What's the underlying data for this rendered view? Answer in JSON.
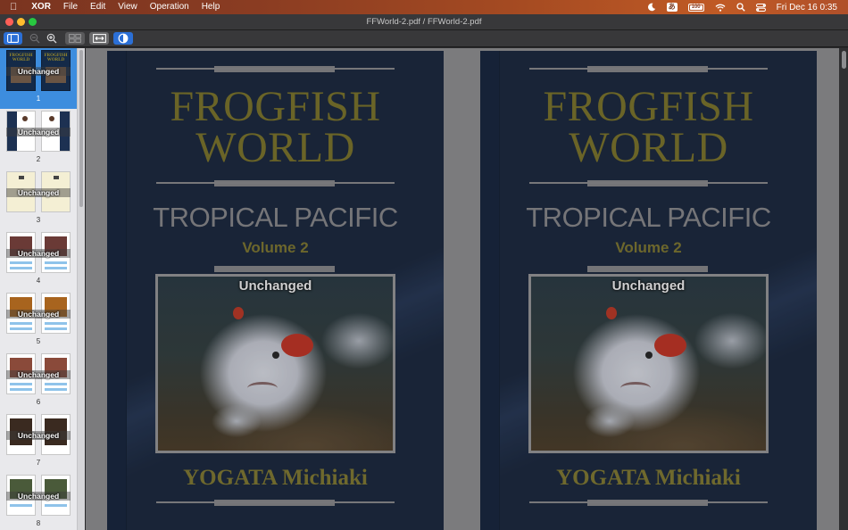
{
  "menubar": {
    "app_name": "XOR",
    "menus": [
      "File",
      "Edit",
      "View",
      "Operation",
      "Help"
    ],
    "status": {
      "input_source": "あ",
      "battery": "100",
      "clock": "Fri Dec 16  0:35"
    }
  },
  "window": {
    "title": "FFWorld-2.pdf / FFWorld-2.pdf"
  },
  "sidebar": {
    "status_label": "Unchanged",
    "selected_index": 0,
    "thumbnails": [
      {
        "number": "1",
        "label": "Unchanged",
        "kind": "cover",
        "mini_title": "FROGFISH WORLD"
      },
      {
        "number": "2",
        "label": "Unchanged",
        "kind": "text-dark"
      },
      {
        "number": "3",
        "label": "Unchanged",
        "kind": "text-cream"
      },
      {
        "number": "4",
        "label": "Unchanged",
        "kind": "photo-red"
      },
      {
        "number": "5",
        "label": "Unchanged",
        "kind": "photo-orange"
      },
      {
        "number": "6",
        "label": "Unchanged",
        "kind": "photo-red"
      },
      {
        "number": "7",
        "label": "Unchanged",
        "kind": "photo-dark"
      },
      {
        "number": "8",
        "label": "Unchanged",
        "kind": "photo-green"
      }
    ]
  },
  "pages": [
    {
      "side": "left",
      "title_line1": "FROGFISH",
      "title_line2": "WORLD",
      "subtitle": "TROPICAL PACIFIC",
      "volume": "Volume 2",
      "photo_label": "Unchanged",
      "author": "YOGATA Michiaki"
    },
    {
      "side": "right",
      "title_line1": "FROGFISH",
      "title_line2": "WORLD",
      "subtitle": "TROPICAL PACIFIC",
      "volume": "Volume 2",
      "photo_label": "Unchanged",
      "author": "YOGATA Michiaki"
    }
  ],
  "colors": {
    "accent": "#2b6fd6",
    "selection": "#3d8dde",
    "cover_bg": "#15233a",
    "title_gold": "#7d7526"
  }
}
